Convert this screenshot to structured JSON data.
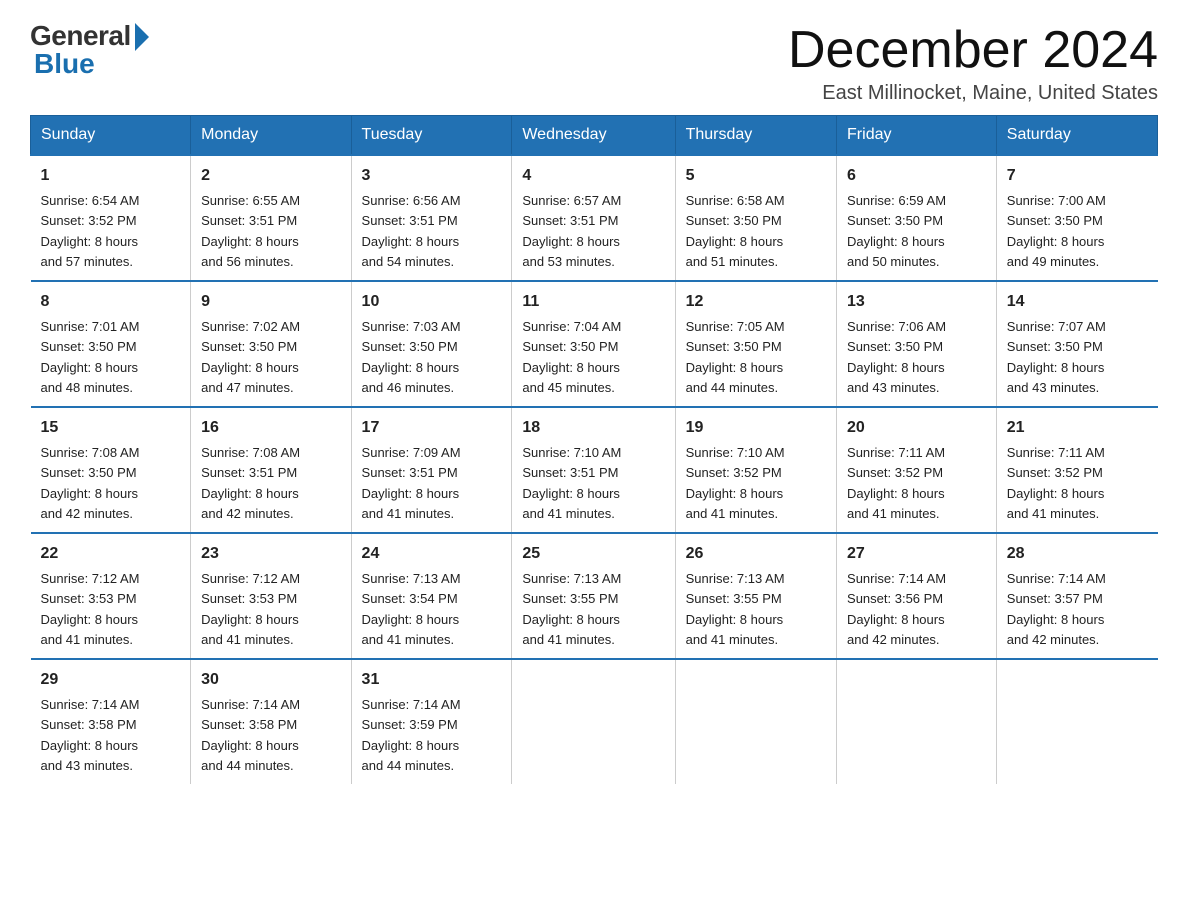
{
  "logo": {
    "general": "General",
    "blue": "Blue"
  },
  "title": "December 2024",
  "location": "East Millinocket, Maine, United States",
  "days_of_week": [
    "Sunday",
    "Monday",
    "Tuesday",
    "Wednesday",
    "Thursday",
    "Friday",
    "Saturday"
  ],
  "weeks": [
    [
      {
        "day": "1",
        "sunrise": "6:54 AM",
        "sunset": "3:52 PM",
        "daylight": "8 hours and 57 minutes."
      },
      {
        "day": "2",
        "sunrise": "6:55 AM",
        "sunset": "3:51 PM",
        "daylight": "8 hours and 56 minutes."
      },
      {
        "day": "3",
        "sunrise": "6:56 AM",
        "sunset": "3:51 PM",
        "daylight": "8 hours and 54 minutes."
      },
      {
        "day": "4",
        "sunrise": "6:57 AM",
        "sunset": "3:51 PM",
        "daylight": "8 hours and 53 minutes."
      },
      {
        "day": "5",
        "sunrise": "6:58 AM",
        "sunset": "3:50 PM",
        "daylight": "8 hours and 51 minutes."
      },
      {
        "day": "6",
        "sunrise": "6:59 AM",
        "sunset": "3:50 PM",
        "daylight": "8 hours and 50 minutes."
      },
      {
        "day": "7",
        "sunrise": "7:00 AM",
        "sunset": "3:50 PM",
        "daylight": "8 hours and 49 minutes."
      }
    ],
    [
      {
        "day": "8",
        "sunrise": "7:01 AM",
        "sunset": "3:50 PM",
        "daylight": "8 hours and 48 minutes."
      },
      {
        "day": "9",
        "sunrise": "7:02 AM",
        "sunset": "3:50 PM",
        "daylight": "8 hours and 47 minutes."
      },
      {
        "day": "10",
        "sunrise": "7:03 AM",
        "sunset": "3:50 PM",
        "daylight": "8 hours and 46 minutes."
      },
      {
        "day": "11",
        "sunrise": "7:04 AM",
        "sunset": "3:50 PM",
        "daylight": "8 hours and 45 minutes."
      },
      {
        "day": "12",
        "sunrise": "7:05 AM",
        "sunset": "3:50 PM",
        "daylight": "8 hours and 44 minutes."
      },
      {
        "day": "13",
        "sunrise": "7:06 AM",
        "sunset": "3:50 PM",
        "daylight": "8 hours and 43 minutes."
      },
      {
        "day": "14",
        "sunrise": "7:07 AM",
        "sunset": "3:50 PM",
        "daylight": "8 hours and 43 minutes."
      }
    ],
    [
      {
        "day": "15",
        "sunrise": "7:08 AM",
        "sunset": "3:50 PM",
        "daylight": "8 hours and 42 minutes."
      },
      {
        "day": "16",
        "sunrise": "7:08 AM",
        "sunset": "3:51 PM",
        "daylight": "8 hours and 42 minutes."
      },
      {
        "day": "17",
        "sunrise": "7:09 AM",
        "sunset": "3:51 PM",
        "daylight": "8 hours and 41 minutes."
      },
      {
        "day": "18",
        "sunrise": "7:10 AM",
        "sunset": "3:51 PM",
        "daylight": "8 hours and 41 minutes."
      },
      {
        "day": "19",
        "sunrise": "7:10 AM",
        "sunset": "3:52 PM",
        "daylight": "8 hours and 41 minutes."
      },
      {
        "day": "20",
        "sunrise": "7:11 AM",
        "sunset": "3:52 PM",
        "daylight": "8 hours and 41 minutes."
      },
      {
        "day": "21",
        "sunrise": "7:11 AM",
        "sunset": "3:52 PM",
        "daylight": "8 hours and 41 minutes."
      }
    ],
    [
      {
        "day": "22",
        "sunrise": "7:12 AM",
        "sunset": "3:53 PM",
        "daylight": "8 hours and 41 minutes."
      },
      {
        "day": "23",
        "sunrise": "7:12 AM",
        "sunset": "3:53 PM",
        "daylight": "8 hours and 41 minutes."
      },
      {
        "day": "24",
        "sunrise": "7:13 AM",
        "sunset": "3:54 PM",
        "daylight": "8 hours and 41 minutes."
      },
      {
        "day": "25",
        "sunrise": "7:13 AM",
        "sunset": "3:55 PM",
        "daylight": "8 hours and 41 minutes."
      },
      {
        "day": "26",
        "sunrise": "7:13 AM",
        "sunset": "3:55 PM",
        "daylight": "8 hours and 41 minutes."
      },
      {
        "day": "27",
        "sunrise": "7:14 AM",
        "sunset": "3:56 PM",
        "daylight": "8 hours and 42 minutes."
      },
      {
        "day": "28",
        "sunrise": "7:14 AM",
        "sunset": "3:57 PM",
        "daylight": "8 hours and 42 minutes."
      }
    ],
    [
      {
        "day": "29",
        "sunrise": "7:14 AM",
        "sunset": "3:58 PM",
        "daylight": "8 hours and 43 minutes."
      },
      {
        "day": "30",
        "sunrise": "7:14 AM",
        "sunset": "3:58 PM",
        "daylight": "8 hours and 44 minutes."
      },
      {
        "day": "31",
        "sunrise": "7:14 AM",
        "sunset": "3:59 PM",
        "daylight": "8 hours and 44 minutes."
      },
      null,
      null,
      null,
      null
    ]
  ],
  "labels": {
    "sunrise": "Sunrise: ",
    "sunset": "Sunset: ",
    "daylight": "Daylight: "
  }
}
